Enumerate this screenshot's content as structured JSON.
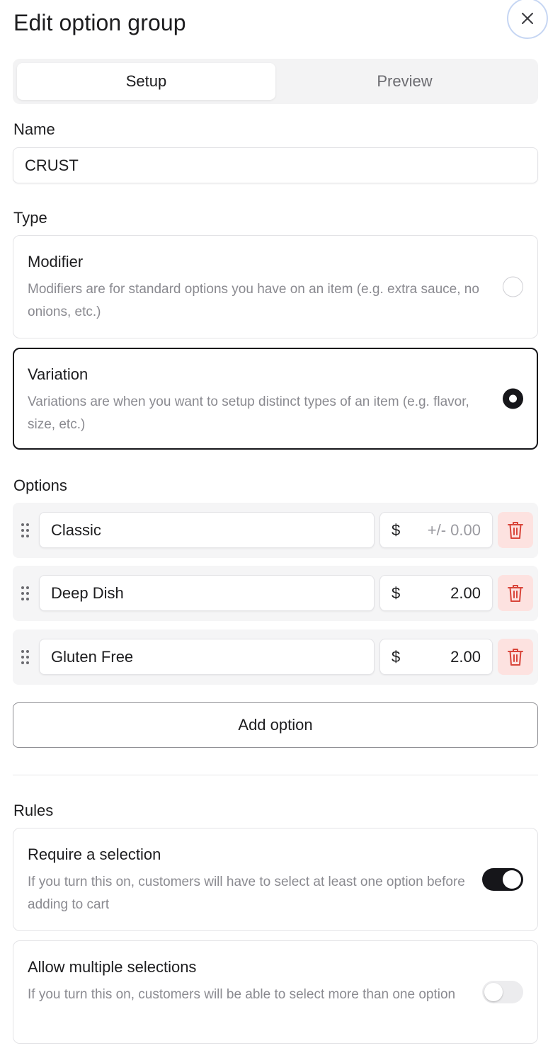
{
  "header": {
    "title": "Edit option group",
    "close_icon": "close-icon"
  },
  "tabs": [
    {
      "label": "Setup",
      "active": true
    },
    {
      "label": "Preview",
      "active": false
    }
  ],
  "name": {
    "label": "Name",
    "value": "CRUST"
  },
  "type": {
    "label": "Type",
    "options": [
      {
        "title": "Modifier",
        "description": "Modifiers are for standard options you have on an item (e.g. extra sauce, no onions, etc.)",
        "selected": false
      },
      {
        "title": "Variation",
        "description": "Variations are when you want to setup distinct types of an item (e.g. flavor, size, etc.)",
        "selected": true
      }
    ]
  },
  "options": {
    "label": "Options",
    "items": [
      {
        "name": "Classic",
        "currency": "$",
        "price": "",
        "price_placeholder": "+/- 0.00"
      },
      {
        "name": "Deep Dish",
        "currency": "$",
        "price": "2.00",
        "price_placeholder": "+/- 0.00"
      },
      {
        "name": "Gluten Free",
        "currency": "$",
        "price": "2.00",
        "price_placeholder": "+/- 0.00"
      }
    ],
    "add_label": "Add option",
    "delete_icon": "trash-icon",
    "drag_icon": "drag-handle-icon"
  },
  "rules": {
    "label": "Rules",
    "items": [
      {
        "title": "Require a selection",
        "description": "If you turn this on, customers will have to select at least one option before adding to cart",
        "enabled": true
      },
      {
        "title": "Allow multiple selections",
        "description": "If you turn this on, customers will be able to select more than one option",
        "enabled": false
      }
    ]
  },
  "colors": {
    "accent": "#16161a",
    "delete_bg": "#fde2e0",
    "delete_icon": "#d9453a",
    "focus_ring": "#c6d6f3"
  }
}
